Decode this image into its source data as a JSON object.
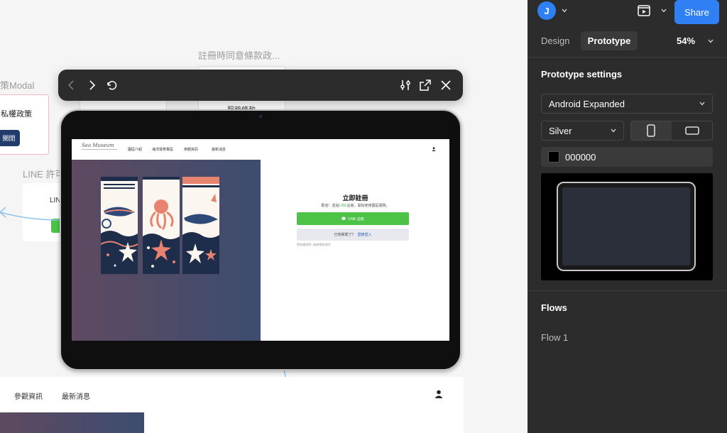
{
  "canvas": {
    "label_terms": "註冊時同意條款政...",
    "label_modal": "策Modal",
    "label_line_permission": "LINE 許可",
    "card_policy_text": "私權政策",
    "card_close_button": "關閉",
    "card_terms_text": "服務條款",
    "card_line_text": "LINE"
  },
  "toolbar": {
    "back_icon": "chevron-left-icon",
    "forward_icon": "chevron-right-icon",
    "restart_icon": "restart-icon",
    "settings_icon": "sliders-icon",
    "open_icon": "external-link-icon",
    "close_icon": "close-icon"
  },
  "prototype_screen": {
    "logo_text": "Sea Museum",
    "nav_items": [
      "園區介紹",
      "海洋保育專區",
      "參觀資訊",
      "最新消息"
    ],
    "form_title": "立即註冊",
    "form_subtitle_prefix": "歡迎！透過",
    "form_subtitle_line": "LINE",
    "form_subtitle_suffix": "註冊，開始使用園區服務。",
    "line_button_label": "LINE 註冊",
    "login_prompt": "已有帳號了？",
    "login_link": "登錄登入",
    "terms_text": "隱私權政策 | 服務條款說明"
  },
  "preview_bottom": {
    "nav_items": [
      "參觀資訊",
      "最新消息"
    ]
  },
  "sidebar": {
    "avatar_initial": "J",
    "share_label": "Share",
    "tabs": [
      {
        "label": "Design",
        "active": false
      },
      {
        "label": "Prototype",
        "active": true
      }
    ],
    "zoom": "54%",
    "prototype_settings_title": "Prototype settings",
    "device": "Android Expanded",
    "device_color": "Silver",
    "background_color": "000000",
    "flows_title": "Flows",
    "flows": [
      "Flow 1"
    ]
  },
  "colors": {
    "accent": "#2f7ff5",
    "line_green": "#4cc247",
    "sidebar_bg": "#2c2c2c",
    "toolbar_bg": "#2c2c2c"
  }
}
